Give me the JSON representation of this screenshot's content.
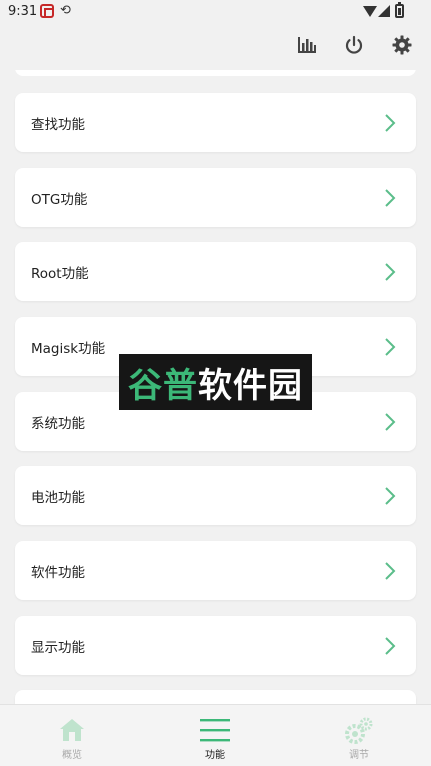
{
  "status_bar": {
    "time": "9:31",
    "sync_icon": "sync-icon",
    "notification_icon": "app-notification-icon"
  },
  "app_bar": {
    "icons": [
      "stats-icon",
      "power-icon",
      "settings-icon"
    ]
  },
  "menu": {
    "items": [
      {
        "label": "查找功能"
      },
      {
        "label": "OTG功能"
      },
      {
        "label": "Root功能"
      },
      {
        "label": "Magisk功能"
      },
      {
        "label": "系统功能"
      },
      {
        "label": "电池功能"
      },
      {
        "label": "软件功能"
      },
      {
        "label": "显示功能"
      }
    ]
  },
  "watermark": {
    "text_green": "谷普",
    "text_white": "软件园"
  },
  "bottom_nav": {
    "items": [
      {
        "label": "概览",
        "icon": "home-icon",
        "active": false
      },
      {
        "label": "功能",
        "icon": "menu-icon",
        "active": true
      },
      {
        "label": "调节",
        "icon": "gears-icon",
        "active": false
      }
    ]
  },
  "colors": {
    "accent": "#3cb878",
    "chevron": "#5bbd8a",
    "background": "#f1f1f1",
    "card": "#ffffff"
  }
}
